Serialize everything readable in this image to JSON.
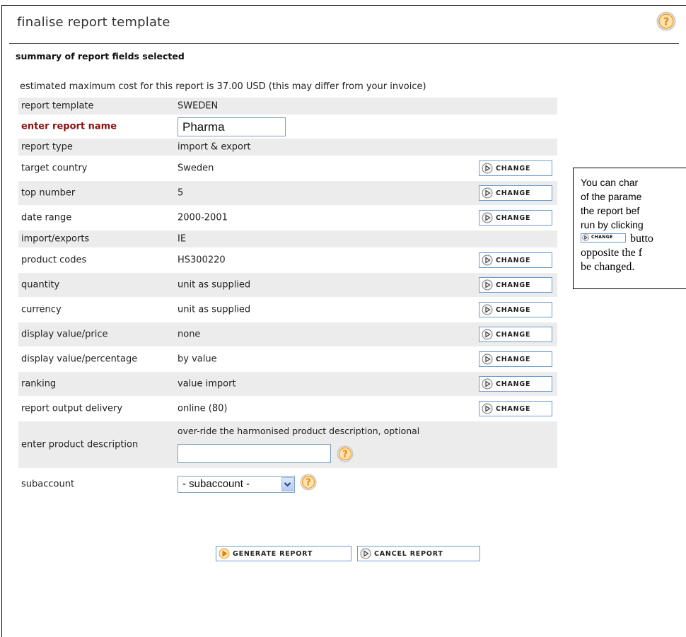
{
  "header": {
    "title": "finalise report template",
    "section_title": "summary of report fields selected"
  },
  "estimate_text": "estimated maximum cost for this report is 37.00 USD (this may differ from your invoice)",
  "fields": {
    "report_template": {
      "label": "report template",
      "value": "SWEDEN"
    },
    "report_name": {
      "label": "enter report name",
      "value": "Pharma"
    },
    "report_type": {
      "label": "report type",
      "value": "import & export"
    },
    "target_country": {
      "label": "target country",
      "value": "Sweden"
    },
    "top_number": {
      "label": "top number",
      "value": "5"
    },
    "date_range": {
      "label": "date range",
      "value": "2000-2001"
    },
    "import_exports": {
      "label": "import/exports",
      "value": "IE"
    },
    "product_codes": {
      "label": "product codes",
      "value": "HS300220"
    },
    "quantity": {
      "label": "quantity",
      "value": "unit as supplied"
    },
    "currency": {
      "label": "currency",
      "value": "unit as supplied"
    },
    "display_value_price": {
      "label": "display value/price",
      "value": "none"
    },
    "display_value_percentage": {
      "label": "display value/percentage",
      "value": "by value"
    },
    "ranking": {
      "label": "ranking",
      "value": "value import"
    },
    "report_output_delivery": {
      "label": "report output delivery",
      "value": "online (80)"
    },
    "product_description": {
      "label": "enter product description",
      "hint": "over-ride the harmonised product description, optional",
      "value": ""
    },
    "subaccount": {
      "label": "subaccount",
      "selected": "- subaccount -"
    }
  },
  "buttons": {
    "change": "CHANGE",
    "generate": "GENERATE REPORT",
    "cancel": "CANCEL REPORT"
  },
  "tooltip": {
    "line1": "You can char",
    "line2": "of the parame",
    "line3": "the report bef",
    "line4": "run by clicking",
    "mini_button": "CHANGE",
    "line5_tail": "butto",
    "line6": "opposite the f",
    "line7": "be changed."
  },
  "colors": {
    "row_shade": "#ececec",
    "required_label": "#8b1111",
    "button_border": "#6a9bd1",
    "help_icon": "#f39c12"
  },
  "icons": {
    "help": "question-circle-icon",
    "play": "play-triangle-icon",
    "dropdown": "chevron-down-icon"
  }
}
